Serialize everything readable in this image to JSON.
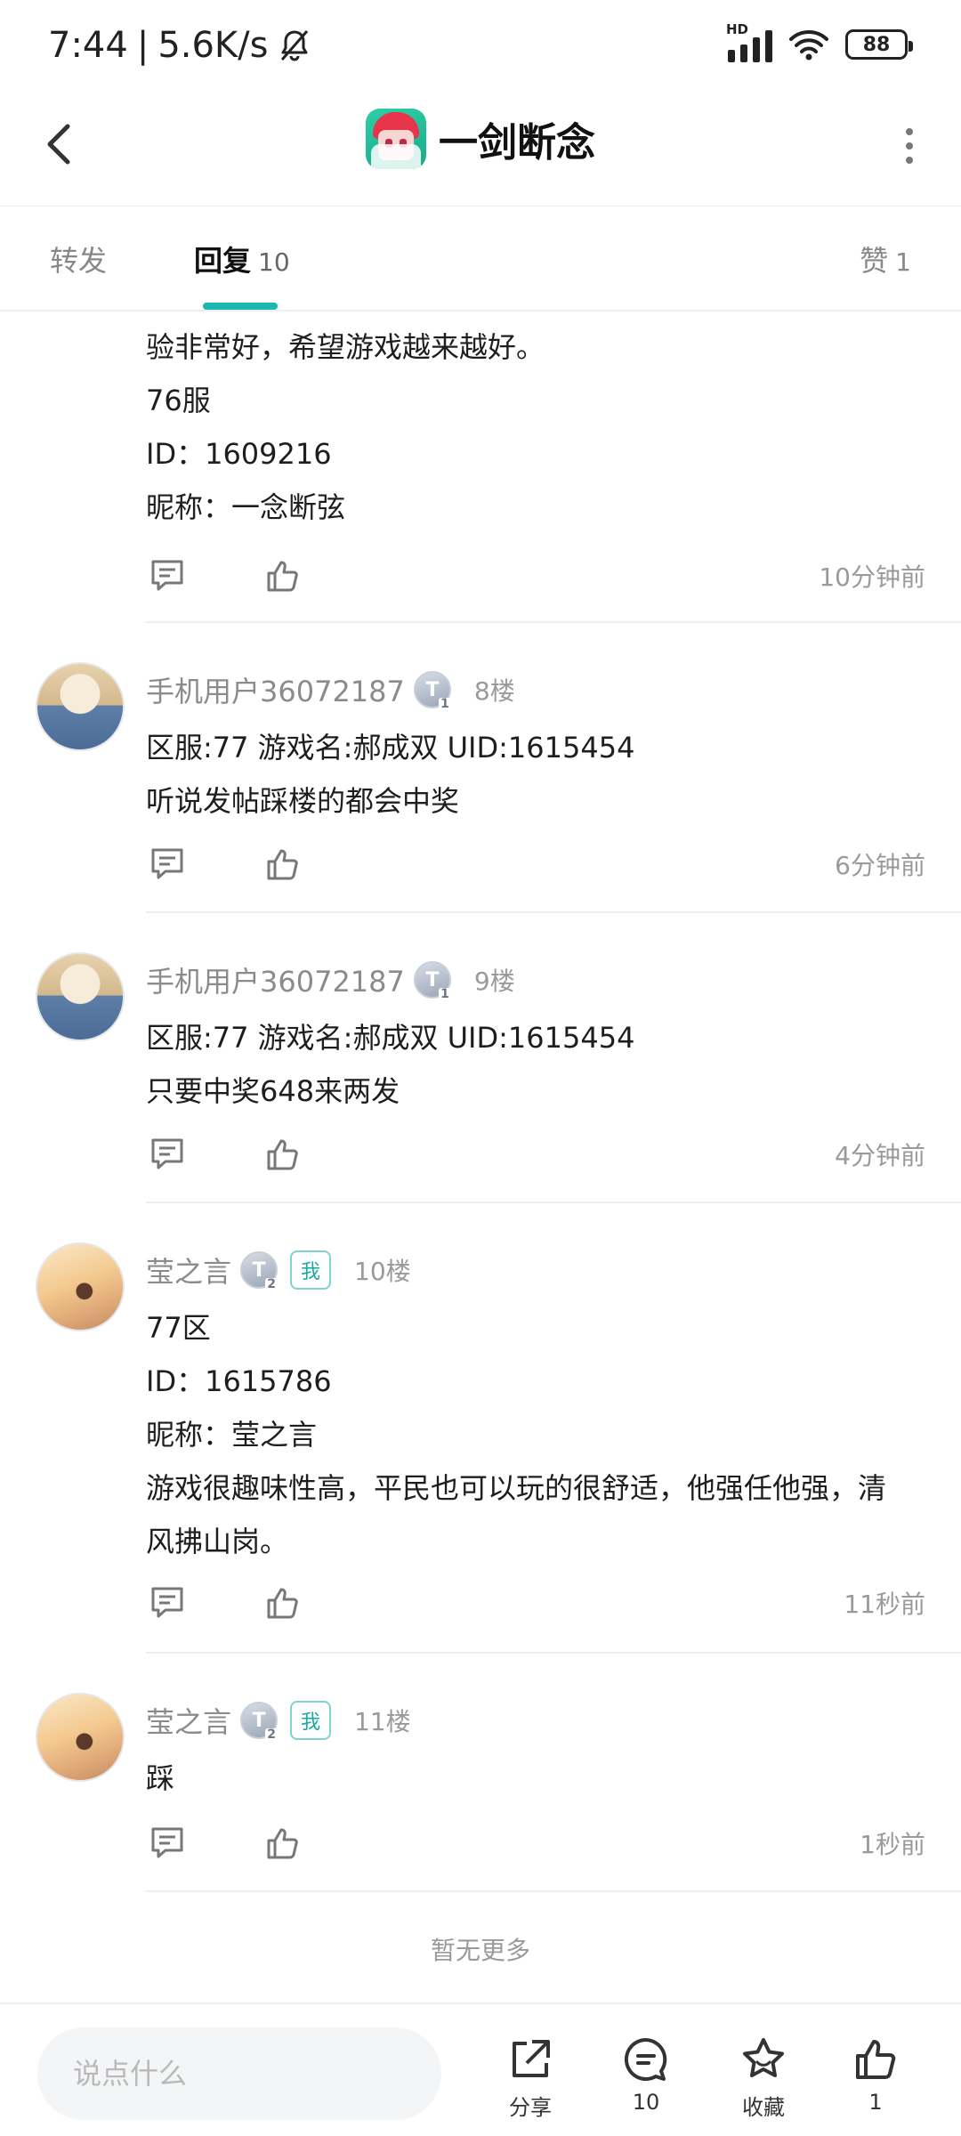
{
  "status_bar": {
    "time": "7:44",
    "separator": "|",
    "speed": "5.6K/s",
    "network_label": "HD",
    "battery": "88"
  },
  "header": {
    "title": "一剑断念",
    "game_icon": "game-app-icon",
    "back_icon": "chevron-left-icon",
    "more_icon": "vertical-dots-icon"
  },
  "tabs": {
    "forward": "转发",
    "reply": "回复",
    "reply_count": "10",
    "like": "赞",
    "like_count": "1",
    "accent": "#1bb8b2"
  },
  "posts": [
    {
      "lines": [
        "验非常好，希望游戏越来越好。",
        "76服",
        "ID：1609216",
        "昵称：一念断弦"
      ],
      "time": "10分钟前"
    },
    {
      "username": "手机用户36072187",
      "level": "T",
      "level_num": "1",
      "floor": "8楼",
      "lines": [
        "区服:77 游戏名:郝成双 UID:1615454",
        "听说发帖踩楼的都会中奖"
      ],
      "time": "6分钟前"
    },
    {
      "username": "手机用户36072187",
      "level": "T",
      "level_num": "1",
      "floor": "9楼",
      "lines": [
        "区服:77 游戏名:郝成双 UID:1615454",
        "只要中奖648来两发"
      ],
      "time": "4分钟前"
    },
    {
      "username": "莹之言",
      "level": "T",
      "level_num": "2",
      "me": "我",
      "floor": "10楼",
      "lines": [
        "77区",
        "ID：1615786",
        "昵称：莹之言",
        "游戏很趣味性高，平民也可以玩的很舒适，他强任他强，清",
        "风拂山岗。"
      ],
      "time": "11秒前"
    },
    {
      "username": "莹之言",
      "level": "T",
      "level_num": "2",
      "me": "我",
      "floor": "11楼",
      "lines": [
        "踩"
      ],
      "time": "1秒前"
    }
  ],
  "no_more": "暂无更多",
  "bottom_bar": {
    "input_placeholder": "说点什么",
    "share_label": "分享",
    "comment_count": "10",
    "favorite_label": "收藏",
    "like_count": "1"
  }
}
